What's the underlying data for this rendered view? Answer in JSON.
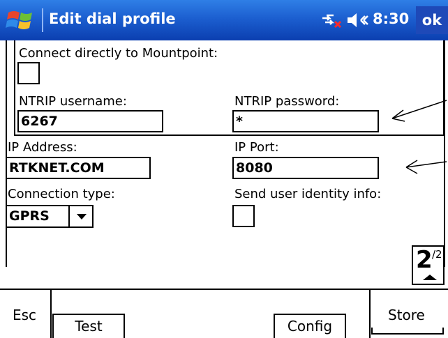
{
  "titlebar": {
    "title": "Edit dial profile",
    "time": "8:30",
    "ok": "ok",
    "accent": "#1c5fd0"
  },
  "mountpoint": {
    "label": "Connect directly to Mountpoint:",
    "checked": false,
    "ntrip_username_label": "NTRIP username:",
    "ntrip_username": "6267",
    "ntrip_password_label": "NTRIP password:",
    "ntrip_password": "*"
  },
  "ip": {
    "address_label": "IP Address:",
    "address": "RTKNET.COM",
    "port_label": "IP Port:",
    "port": "8080"
  },
  "connection": {
    "type_label": "Connection type:",
    "type": "GPRS",
    "send_identity_label": "Send user identity info:",
    "send_identity": false
  },
  "pager": {
    "current": "2",
    "total": "/2"
  },
  "softbar": {
    "esc": "Esc",
    "test": "Test",
    "config": "Config",
    "store": "Store"
  }
}
